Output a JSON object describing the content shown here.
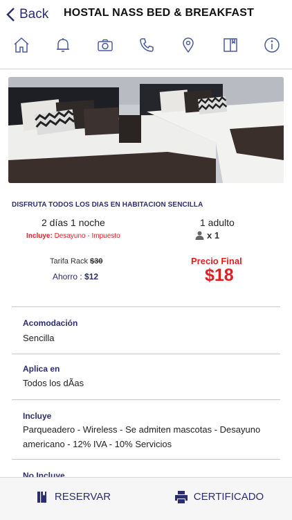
{
  "header": {
    "back_label": "Back",
    "title": "HOSTAL NASS BED & BREAKFAST"
  },
  "tabs": [
    {
      "icon": "home-icon"
    },
    {
      "icon": "bell-icon"
    },
    {
      "icon": "camera-icon"
    },
    {
      "icon": "phone-icon"
    },
    {
      "icon": "map-pin-icon"
    },
    {
      "icon": "book-icon"
    },
    {
      "icon": "info-icon"
    }
  ],
  "offer": {
    "headline": "DISFRUTA TODOS LOS DIAS EN HABITACION SENCILLA",
    "stay": "2 días 1 noche",
    "includes_label": "Incluye:",
    "includes_value": "Desayuno - Impuesto",
    "occupancy": "1 adulto",
    "guests": "x 1",
    "rack_label": "Tarifa Rack",
    "rack_price": "$30",
    "savings_label": "Ahorro :",
    "savings_value": "$12",
    "final_label": "Precio Final",
    "final_price": "$18"
  },
  "sections": [
    {
      "title": "Acomodación",
      "text": "Sencilla"
    },
    {
      "title": "Aplica en",
      "text": "Todos los dÃas"
    },
    {
      "title": "Incluye",
      "text": "Parqueadero - Wireless - Se admiten mascotas - Desayuno americano - 12% IVA - 10% Servicios"
    },
    {
      "title": "No Incluye",
      "text": ""
    }
  ],
  "bottom": {
    "reserve_label": "RESERVAR",
    "certificate_label": "CERTIFICADO"
  },
  "colors": {
    "brand": "#2b2e6e",
    "accent_red": "#e02020",
    "icon": "#4a5aa0"
  }
}
